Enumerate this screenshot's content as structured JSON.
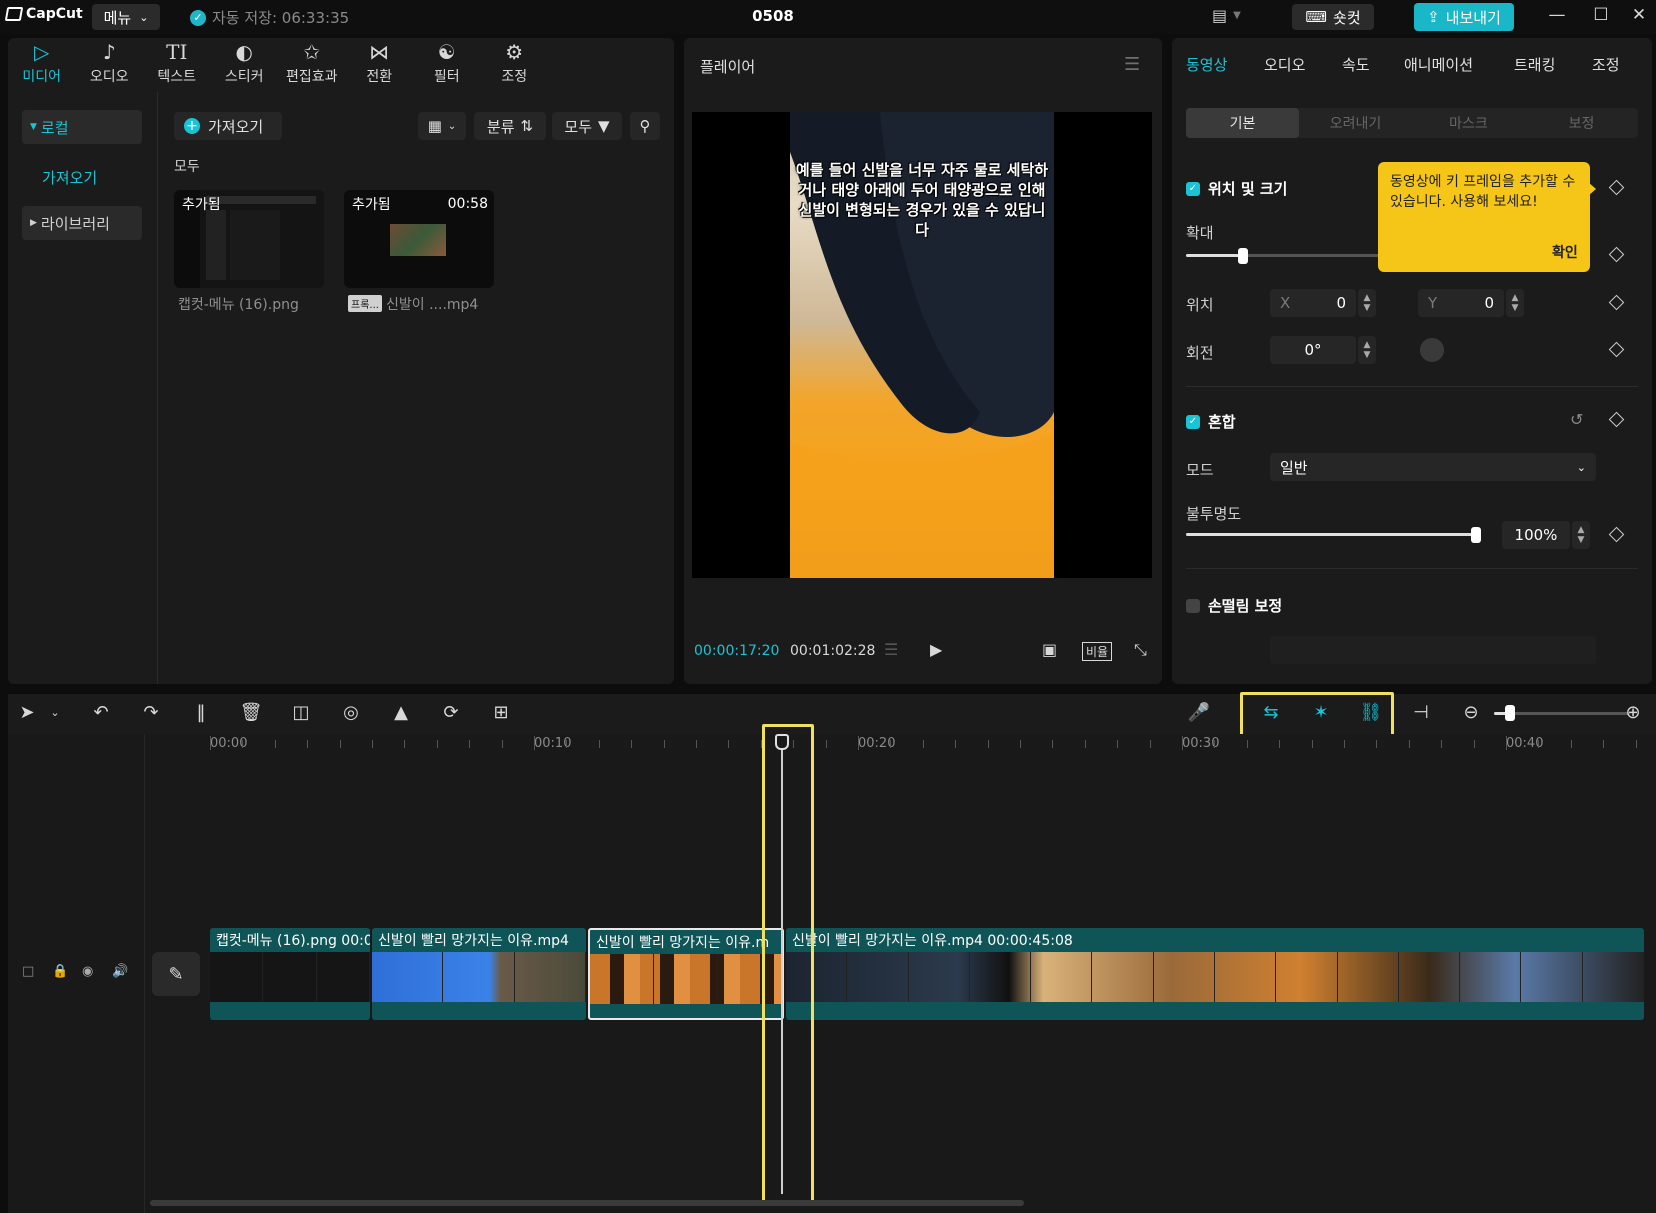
{
  "app": {
    "logo_text": "CapCut",
    "menu_label": "메뉴",
    "autosave_text": "자동 저장: 06:33:35",
    "project_title": "0508",
    "shortcut_label": "숏컷",
    "export_label": "내보내기"
  },
  "media_panel": {
    "tabs": [
      {
        "label": "미디어",
        "icon": "media-icon"
      },
      {
        "label": "오디오",
        "icon": "audio-icon"
      },
      {
        "label": "텍스트",
        "icon": "text-icon"
      },
      {
        "label": "스티커",
        "icon": "sticker-icon"
      },
      {
        "label": "편집효과",
        "icon": "effects-icon"
      },
      {
        "label": "전환",
        "icon": "transition-icon"
      },
      {
        "label": "필터",
        "icon": "filter-icon"
      },
      {
        "label": "조정",
        "icon": "adjust-icon"
      }
    ],
    "sidebar": {
      "local": "로컬",
      "import": "가져오기",
      "library": "라이브러리"
    },
    "import_button": "가져오기",
    "sort_label": "분류",
    "filter_label": "모두",
    "section_label": "모두",
    "items": [
      {
        "badge": "추가됨",
        "duration": "",
        "name": "캡컷-메뉴 (16).png"
      },
      {
        "badge": "추가됨",
        "duration": "00:58",
        "name": "신발이 ....mp4",
        "tag": "프록..."
      }
    ]
  },
  "player": {
    "title": "플레이어",
    "caption": "예를 들어 신발을 너무 자주 물로 세탁하거나 태양 아래에 두어 태양광으로 인해 신발이 변형되는 경우가 있을 수 있답니다",
    "current_time": "00:00:17:20",
    "total_time": "00:01:02:28",
    "ratio_label": "비율"
  },
  "properties": {
    "tabs": [
      "동영상",
      "오디오",
      "속도",
      "애니메이션",
      "트래킹",
      "조정"
    ],
    "subtabs": [
      "기본",
      "오려내기",
      "마스크",
      "보정"
    ],
    "position_size": {
      "title": "위치 및 크기",
      "scale_label": "확대",
      "scale_value": 0.19,
      "position_label": "위치",
      "x_key": "X",
      "x_value": "0",
      "y_key": "Y",
      "y_value": "0",
      "rotation_label": "회전",
      "rotation_value": "0°"
    },
    "blend": {
      "title": "혼합",
      "mode_label": "모드",
      "mode_value": "일반",
      "opacity_label": "불투명도",
      "opacity_value": "100%",
      "opacity_fraction": 1.0
    },
    "stabilize": {
      "title": "손떨림 보정"
    },
    "tooltip": {
      "text": "동영상에 키 프레임을 추가할 수 있습니다. 사용해 보세요!",
      "ok": "확인"
    }
  },
  "timeline": {
    "ruler": [
      "00:00",
      "00:10",
      "00:20",
      "00:30",
      "00:40"
    ],
    "clips": [
      {
        "title": "캡컷-메뉴 (16).png  00:0"
      },
      {
        "title": "신발이 빨리 망가지는 이유.mp4"
      },
      {
        "title": "신발이 빨리 망가지는 이유.m"
      },
      {
        "title": "신발이 빨리 망가지는 이유.mp4  00:00:45:08"
      }
    ],
    "zoom_level": 0.12
  },
  "colors": {
    "accent": "#19c4d4",
    "highlight": "#f0e060",
    "tooltip": "#f5c518",
    "clip": "#0f5557"
  }
}
